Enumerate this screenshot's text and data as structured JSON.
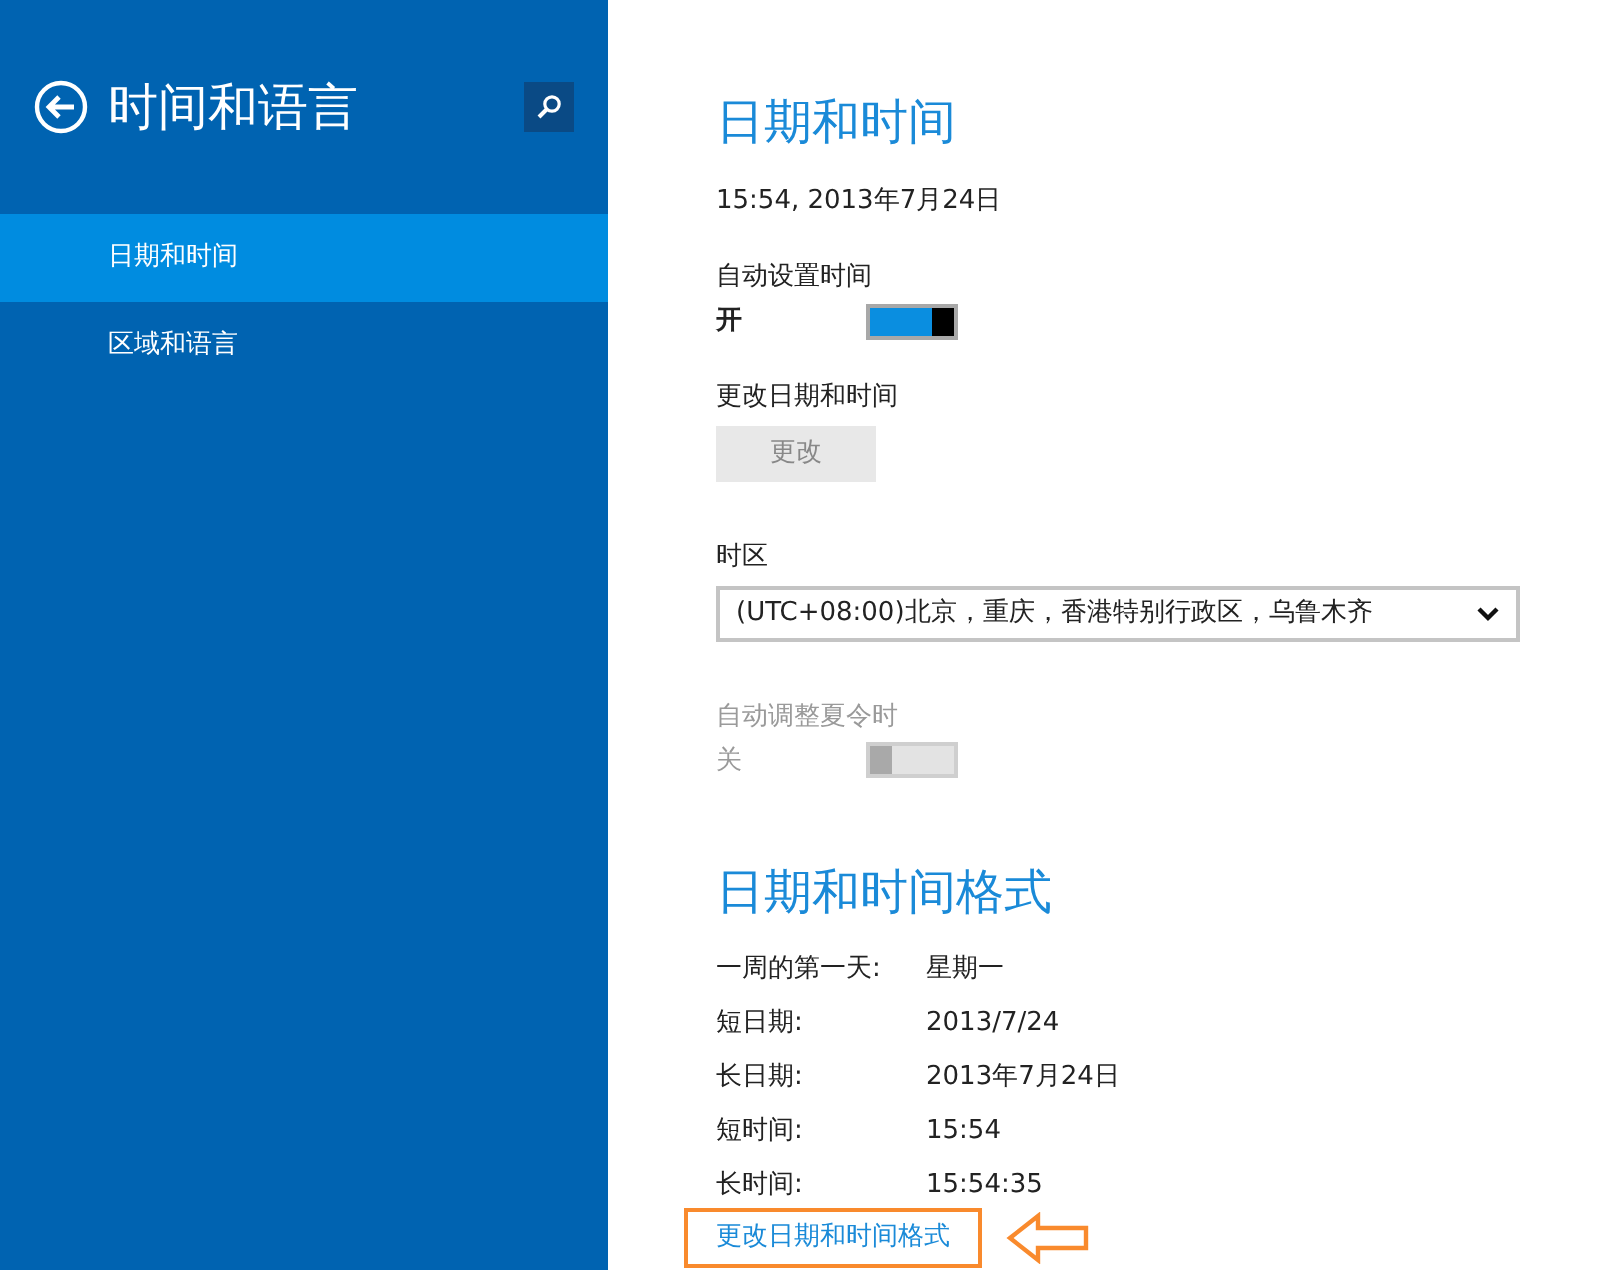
{
  "sidebar": {
    "title": "时间和语言",
    "items": [
      {
        "label": "日期和时间",
        "selected": true
      },
      {
        "label": "区域和语言",
        "selected": false
      }
    ]
  },
  "main": {
    "title": "日期和时间",
    "current_datetime": "15:54, 2013年7月24日",
    "settings": [
      {
        "kind": "toggle",
        "label": "自动设置时间",
        "state_text": "开",
        "on": true,
        "disabled": false
      },
      {
        "kind": "button",
        "label": "更改日期和时间",
        "button": "更改",
        "disabled": true
      },
      {
        "kind": "select",
        "label": "时区",
        "value": "(UTC+08:00)北京，重庆，香港特别行政区，乌鲁木齐"
      },
      {
        "kind": "toggle",
        "label": "自动调整夏令时",
        "state_text": "关",
        "on": false,
        "disabled": true
      }
    ]
  },
  "formats": {
    "title": "日期和时间格式",
    "rows": [
      {
        "label": "一周的第一天:",
        "value": "星期一"
      },
      {
        "label": "短日期:",
        "value": "2013/7/24"
      },
      {
        "label": "长日期:",
        "value": "2013年7月24日"
      },
      {
        "label": "短时间:",
        "value": "15:54"
      },
      {
        "label": "长时间:",
        "value": "15:54:35"
      }
    ],
    "link": {
      "text": "更改日期和时间格式",
      "highlighted": true
    }
  }
}
